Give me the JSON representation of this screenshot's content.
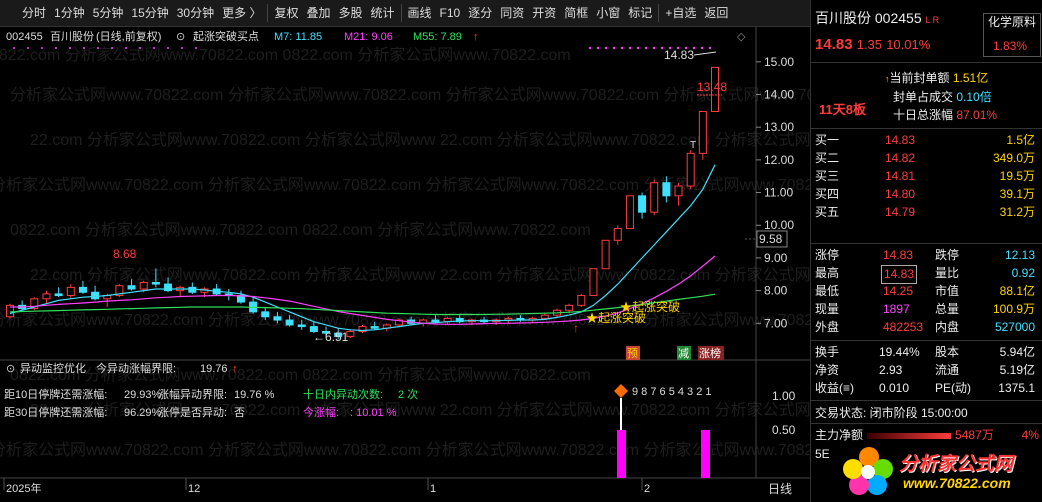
{
  "toolbar": {
    "items": [
      "分时",
      "1分钟",
      "5分钟",
      "15分钟",
      "30分钟",
      "更多",
      "复权",
      "叠加",
      "多股",
      "统计",
      "画线",
      "F10",
      "逐分",
      "同资",
      "开资",
      "简框",
      "小窗",
      "标记",
      "+自选",
      "返回"
    ],
    "more_arrow": "〉"
  },
  "chart_header": {
    "code": "002455",
    "name": "百川股份",
    "mode": "(日线,前复权)",
    "indicator": "起涨突破买点",
    "ma7": "M7: 11.85",
    "ma21": "M21: 9.06",
    "ma55": "M55: 7.89",
    "up_arrow": "↑"
  },
  "price_axis": [
    "15.00",
    "14.00",
    "13.00",
    "12.00",
    "11.00",
    "10.00",
    "9.00",
    "8.00",
    "7.00"
  ],
  "price_axis_current": "9.58",
  "annotations": {
    "high": "14.83",
    "high_marker": "13.48",
    "peak_left": "8.68",
    "low": "6.51",
    "low_prefix": "←",
    "breakout_label": "★起涨突破",
    "t_mark": "T",
    "pre": "预",
    "jian": "减",
    "zhangbang": "涨榜"
  },
  "sub_panel": {
    "title": "异动监控优化",
    "label": "今异动涨幅界限:",
    "value": "19.76",
    "arrow": "↑",
    "lines": [
      {
        "label": "距10日停牌还需涨幅:",
        "value": "29.93%",
        "label2": "涨幅异动界限:",
        "value2": "19.76 %",
        "label3": "十日内异动次数:",
        "value3": "2 次"
      },
      {
        "label": "距30日停牌还需涨幅:",
        "value": "96.29%",
        "label2": "涨停是否异动:",
        "value2": "否",
        "label3": "今涨幅:",
        "value3": ":  10.01 %"
      }
    ],
    "countdown": "9 8 7 6 5 4 3 2 1",
    "axis": [
      "1.00",
      "0.50"
    ]
  },
  "date_axis": [
    "2025年",
    "12",
    "1",
    "2"
  ],
  "period": "日线",
  "watermarks": [
    "0822.com 分析家公式网www.70822.com",
    "分析家公式网www.70822.com 分析家公式网www.70822.com",
    "22.com 分析家公式网www.70822.com 分析家公式网www"
  ],
  "quote": {
    "name": "百川股份",
    "code": "002455",
    "lr": "L R",
    "price": "14.83",
    "change": "1.35",
    "pct": "10.01%",
    "sector": "化学原料",
    "sector_pct": "1.83%",
    "seal_label": "当前封单额",
    "seal_value": "1.51亿",
    "seal_ratio_label": "封单占成交",
    "seal_ratio": "0.10倍",
    "ten_day_label": "十日总涨幅",
    "ten_day": "87.01%",
    "streak": "11天8板",
    "bids": [
      {
        "l": "买一",
        "p": "14.83",
        "v": "1.5亿"
      },
      {
        "l": "买二",
        "p": "14.82",
        "v": "349.0万"
      },
      {
        "l": "买三",
        "p": "14.81",
        "v": "19.5万"
      },
      {
        "l": "买四",
        "p": "14.80",
        "v": "39.1万"
      },
      {
        "l": "买五",
        "p": "14.79",
        "v": "31.2万"
      }
    ],
    "stats": [
      [
        "涨停",
        "14.83",
        "跌停",
        "12.13"
      ],
      [
        "最高",
        "14.83",
        "量比",
        "0.92"
      ],
      [
        "最低",
        "14.25",
        "市值",
        "88.1亿"
      ],
      [
        "现量",
        "1897",
        "总量",
        "100.9万"
      ],
      [
        "外盘",
        "482253",
        "内盘",
        "527000"
      ]
    ],
    "stats2": [
      [
        "换手",
        "19.44%",
        "股本",
        "5.94亿"
      ],
      [
        "净资",
        "2.93",
        "流通",
        "5.19亿"
      ],
      [
        "收益(≡)",
        "0.010",
        "PE(动)",
        "1375.1"
      ]
    ],
    "status": "交易状态: 闭市阶段 15:00:00",
    "capital_label": "主力净额",
    "capital_value": "5487万",
    "capital_pct": "4%",
    "five_e": "5E",
    "logo_text": "分析家公式网",
    "logo_url": "www.70822.com"
  },
  "colors": {
    "up": "#ff3c3c",
    "down": "#3fe0ff",
    "ma7": "#3fe0ff",
    "ma21": "#ff40ff",
    "ma55": "#2ee05a"
  },
  "chart_data": {
    "type": "candlestick",
    "description_values": {
      "last_close": 14.83,
      "high": 14.83,
      "low": 6.51,
      "peak_dec": 8.68
    },
    "ylim": [
      6.0,
      15.3
    ],
    "candles": [
      [
        7.2,
        7.6,
        7.15,
        7.55
      ],
      [
        7.55,
        7.7,
        7.4,
        7.45
      ],
      [
        7.45,
        7.8,
        7.4,
        7.75
      ],
      [
        7.75,
        8.0,
        7.6,
        7.9
      ],
      [
        7.9,
        8.1,
        7.8,
        7.85
      ],
      [
        7.85,
        8.2,
        7.75,
        8.1
      ],
      [
        8.1,
        8.3,
        7.9,
        7.95
      ],
      [
        7.95,
        8.15,
        7.7,
        7.75
      ],
      [
        7.75,
        7.9,
        7.5,
        7.85
      ],
      [
        7.85,
        8.2,
        7.8,
        8.15
      ],
      [
        8.15,
        8.35,
        8.0,
        8.05
      ],
      [
        8.05,
        8.3,
        7.95,
        8.25
      ],
      [
        8.25,
        8.68,
        8.1,
        8.2
      ],
      [
        8.2,
        8.4,
        7.95,
        8.0
      ],
      [
        8.0,
        8.15,
        7.8,
        8.1
      ],
      [
        8.1,
        8.25,
        7.9,
        7.95
      ],
      [
        7.95,
        8.1,
        7.8,
        8.05
      ],
      [
        8.05,
        8.2,
        7.85,
        7.9
      ],
      [
        7.9,
        8.05,
        7.7,
        7.85
      ],
      [
        7.85,
        8.0,
        7.6,
        7.65
      ],
      [
        7.65,
        7.8,
        7.3,
        7.35
      ],
      [
        7.35,
        7.5,
        7.1,
        7.2
      ],
      [
        7.2,
        7.35,
        7.0,
        7.1
      ],
      [
        7.1,
        7.25,
        6.9,
        6.95
      ],
      [
        6.95,
        7.1,
        6.8,
        6.9
      ],
      [
        6.9,
        7.05,
        6.7,
        6.75
      ],
      [
        6.75,
        6.9,
        6.6,
        6.7
      ],
      [
        6.7,
        6.85,
        6.51,
        6.6
      ],
      [
        6.6,
        6.8,
        6.55,
        6.75
      ],
      [
        6.75,
        6.95,
        6.7,
        6.9
      ],
      [
        6.9,
        7.05,
        6.8,
        6.85
      ],
      [
        6.85,
        7.0,
        6.75,
        6.95
      ],
      [
        6.95,
        7.15,
        6.9,
        7.1
      ],
      [
        7.1,
        7.2,
        6.95,
        7.0
      ],
      [
        7.0,
        7.15,
        6.9,
        7.1
      ],
      [
        7.1,
        7.25,
        7.0,
        7.05
      ],
      [
        7.05,
        7.2,
        6.95,
        7.15
      ],
      [
        7.15,
        7.25,
        7.0,
        7.05
      ],
      [
        7.05,
        7.15,
        6.95,
        7.1
      ],
      [
        7.1,
        7.2,
        7.0,
        7.05
      ],
      [
        7.05,
        7.15,
        6.95,
        7.1
      ],
      [
        7.1,
        7.2,
        7.0,
        7.15
      ],
      [
        7.15,
        7.25,
        7.05,
        7.1
      ],
      [
        7.1,
        7.2,
        7.0,
        7.15
      ],
      [
        7.15,
        7.3,
        7.1,
        7.25
      ],
      [
        7.25,
        7.45,
        7.15,
        7.4
      ],
      [
        7.4,
        7.6,
        7.3,
        7.55
      ],
      [
        7.55,
        7.9,
        7.5,
        7.85
      ],
      [
        7.85,
        8.67,
        7.85,
        8.67
      ],
      [
        8.67,
        9.54,
        8.67,
        9.54
      ],
      [
        9.54,
        10.0,
        9.4,
        9.9
      ],
      [
        9.9,
        10.9,
        9.9,
        10.9
      ],
      [
        10.9,
        11.0,
        10.2,
        10.4
      ],
      [
        10.4,
        11.4,
        10.3,
        11.3
      ],
      [
        11.3,
        11.5,
        10.7,
        10.9
      ],
      [
        10.9,
        11.3,
        10.6,
        11.2
      ],
      [
        11.2,
        12.3,
        11.1,
        12.2
      ],
      [
        12.2,
        13.48,
        12.0,
        13.48
      ],
      [
        13.48,
        14.83,
        13.48,
        14.83
      ]
    ],
    "ma7": [
      7.3,
      7.4,
      7.5,
      7.6,
      7.7,
      7.75,
      7.8,
      7.82,
      7.85,
      7.9,
      7.95,
      8.0,
      8.05,
      8.05,
      8.05,
      8.05,
      8.02,
      7.98,
      7.95,
      7.9,
      7.8,
      7.65,
      7.5,
      7.35,
      7.2,
      7.05,
      6.95,
      6.85,
      6.8,
      6.78,
      6.8,
      6.85,
      6.9,
      6.95,
      7.0,
      7.02,
      7.05,
      7.07,
      7.08,
      7.08,
      7.08,
      7.09,
      7.1,
      7.1,
      7.12,
      7.18,
      7.25,
      7.35,
      7.55,
      7.85,
      8.2,
      8.6,
      9.0,
      9.4,
      9.8,
      10.2,
      10.6,
      11.1,
      11.85
    ],
    "ma21": [
      7.5,
      7.5,
      7.52,
      7.55,
      7.58,
      7.6,
      7.62,
      7.65,
      7.68,
      7.7,
      7.72,
      7.75,
      7.78,
      7.8,
      7.82,
      7.83,
      7.84,
      7.85,
      7.85,
      7.84,
      7.82,
      7.78,
      7.73,
      7.68,
      7.6,
      7.52,
      7.44,
      7.36,
      7.3,
      7.24,
      7.18,
      7.12,
      7.08,
      7.04,
      7.0,
      6.98,
      6.97,
      6.97,
      6.98,
      6.99,
      7.0,
      7.0,
      7.01,
      7.02,
      7.03,
      7.05,
      7.07,
      7.1,
      7.15,
      7.22,
      7.32,
      7.45,
      7.6,
      7.78,
      7.98,
      8.2,
      8.45,
      8.75,
      9.06
    ],
    "ma55": [
      7.35,
      7.36,
      7.37,
      7.38,
      7.39,
      7.4,
      7.41,
      7.42,
      7.43,
      7.44,
      7.45,
      7.46,
      7.47,
      7.48,
      7.49,
      7.5,
      7.5,
      7.5,
      7.5,
      7.5,
      7.49,
      7.48,
      7.47,
      7.46,
      7.45,
      7.43,
      7.41,
      7.39,
      7.37,
      7.35,
      7.33,
      7.31,
      7.3,
      7.29,
      7.28,
      7.27,
      7.27,
      7.27,
      7.27,
      7.27,
      7.28,
      7.28,
      7.29,
      7.3,
      7.31,
      7.32,
      7.34,
      7.36,
      7.4,
      7.44,
      7.48,
      7.53,
      7.58,
      7.63,
      7.68,
      7.73,
      7.78,
      7.83,
      7.89
    ]
  }
}
